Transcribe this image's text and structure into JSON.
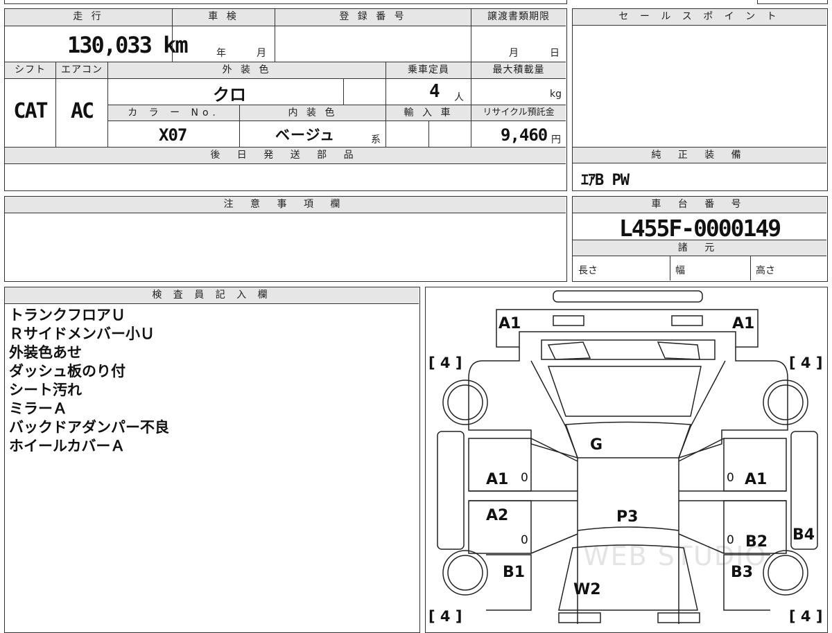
{
  "vehicle": {
    "labels": {
      "mileage": "走 行",
      "inspection": "車 検",
      "registration": "登 録 番 号",
      "transfer_deadline": "譲渡書類期限",
      "shift": "シフト",
      "aircon": "エアコン",
      "exterior_color": "外 装 色",
      "capacity": "乗車定員",
      "max_load": "最大積載量",
      "color_no": "カ ラ ー No.",
      "interior_color": "内 装 色",
      "import": "輸 入 車",
      "recycle_fee": "リサイクル預託金",
      "later_parts": "後 日 発 送 部 品"
    },
    "mileage": "130,033",
    "mileage_unit": "km",
    "inspection_year_unit": "年",
    "inspection_month_unit": "月",
    "transfer_month_unit": "月",
    "transfer_day_unit": "日",
    "shift": "CAT",
    "aircon": "AC",
    "exterior_color": "クロ",
    "capacity": "4",
    "capacity_unit": "人",
    "max_load_unit": "kg",
    "color_no": "X07",
    "interior_color": "ベージュ",
    "interior_suffix": "系",
    "recycle_fee": "9,460",
    "recycle_unit": "円"
  },
  "sales_point": {
    "title": "セ ー ル ス ポ イ ン ト"
  },
  "genuine_equipment": {
    "title": "純 正 装 備",
    "value": "ｴｱB PW"
  },
  "caution": {
    "title": "注 意 事 項 欄"
  },
  "chassis": {
    "title": "車 台 番 号",
    "number": "L455F-0000149"
  },
  "specs": {
    "title": "諸 元",
    "length": "長さ",
    "width": "幅",
    "height": "高さ"
  },
  "inspector": {
    "title": "検 査 員 記 入 欄",
    "notes": [
      "トランクフロアＵ",
      "Ｒサイドメンバー小Ｕ",
      "外装色あせ",
      "ダッシュ板のり付",
      "シート汚れ",
      "ミラーＡ",
      "バックドアダンパー不良",
      "ホイールカバーＡ"
    ]
  },
  "diagram": {
    "marks": {
      "front_left": "A1",
      "front_right": "A1",
      "hood": "G",
      "roof": "P3",
      "left_front_door": "A1",
      "right_front_door": "A1",
      "left_rear_door": "A2",
      "right_rear_door": "B2",
      "left_rear_quarter": "B1",
      "right_rear_quarter": "B3",
      "right_side": "B4",
      "rear_glass": "W2",
      "door_zero_1": "0",
      "door_zero_2": "0",
      "door_zero_3": "0",
      "door_zero_4": "0",
      "tire_fl": "[ 4 ]",
      "tire_fr": "[ 4 ]",
      "tire_rl": "[ 4 ]",
      "tire_rr": "[ 4 ]"
    },
    "watermark": "WEB STUDIO"
  }
}
